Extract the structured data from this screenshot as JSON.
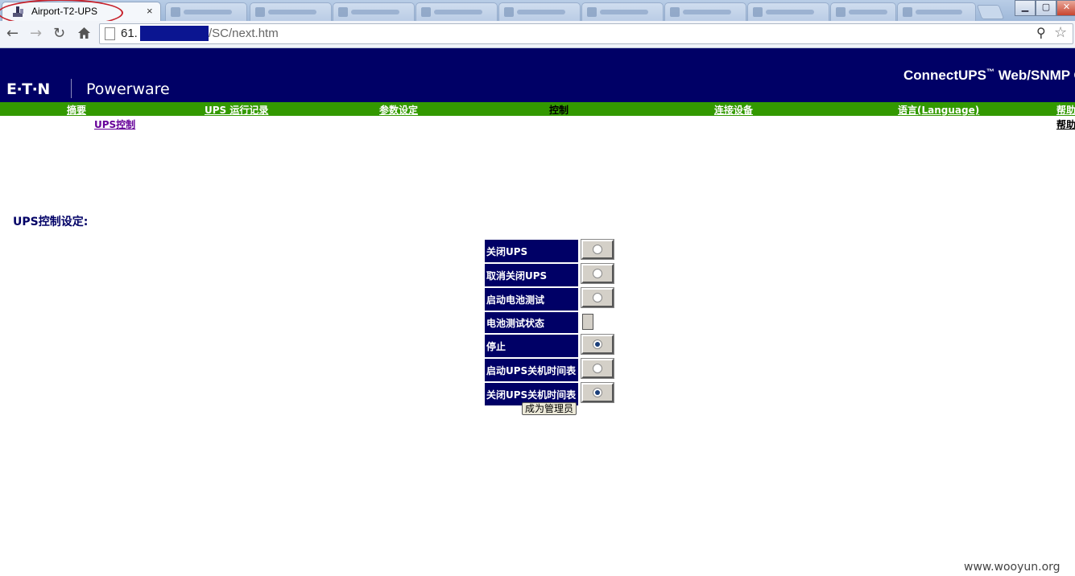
{
  "browser": {
    "tab_title": "Airport-T2-UPS",
    "tab_close": "×",
    "url_visible_start": "61.",
    "url_visible_end": "/SC/next.htm"
  },
  "header": {
    "logo_eaton": "E·T·N",
    "logo_powerware": "Powerware",
    "product_name": "ConnectUPS",
    "product_tm": "™",
    "product_suffix": " Web/SNMP C"
  },
  "menu": {
    "items": [
      {
        "label": "摘要"
      },
      {
        "label": "UPS 运行记录"
      },
      {
        "label": "参数设定"
      },
      {
        "label": "控制",
        "current": true
      },
      {
        "label": "连接设备"
      },
      {
        "label": "语言(Language)"
      },
      {
        "label": "帮助"
      }
    ],
    "submenu": "UPS控制",
    "help_sub": "帮助"
  },
  "content": {
    "section_title": "UPS控制设定:",
    "controls": [
      {
        "label": "关闭UPS",
        "type": "radio",
        "checked": false
      },
      {
        "label": "取消关闭UPS",
        "type": "radio",
        "checked": false
      },
      {
        "label": "启动电池测试",
        "type": "radio",
        "checked": false
      },
      {
        "label": "电池测试状态",
        "type": "status",
        "value": ""
      },
      {
        "label": "停止",
        "type": "radio",
        "checked": true
      },
      {
        "label": "启动UPS关机时间表",
        "type": "radio",
        "checked": false
      },
      {
        "label": "关闭UPS关机时间表",
        "type": "radio",
        "checked": true
      }
    ],
    "admin_button": "成为管理员"
  },
  "watermark": "www.wooyun.org",
  "colors": {
    "banner": "#000066",
    "menubar": "#339900",
    "label_bg": "#000066",
    "redaction": "#0b1591",
    "tab_highlight": "#c6202a"
  }
}
